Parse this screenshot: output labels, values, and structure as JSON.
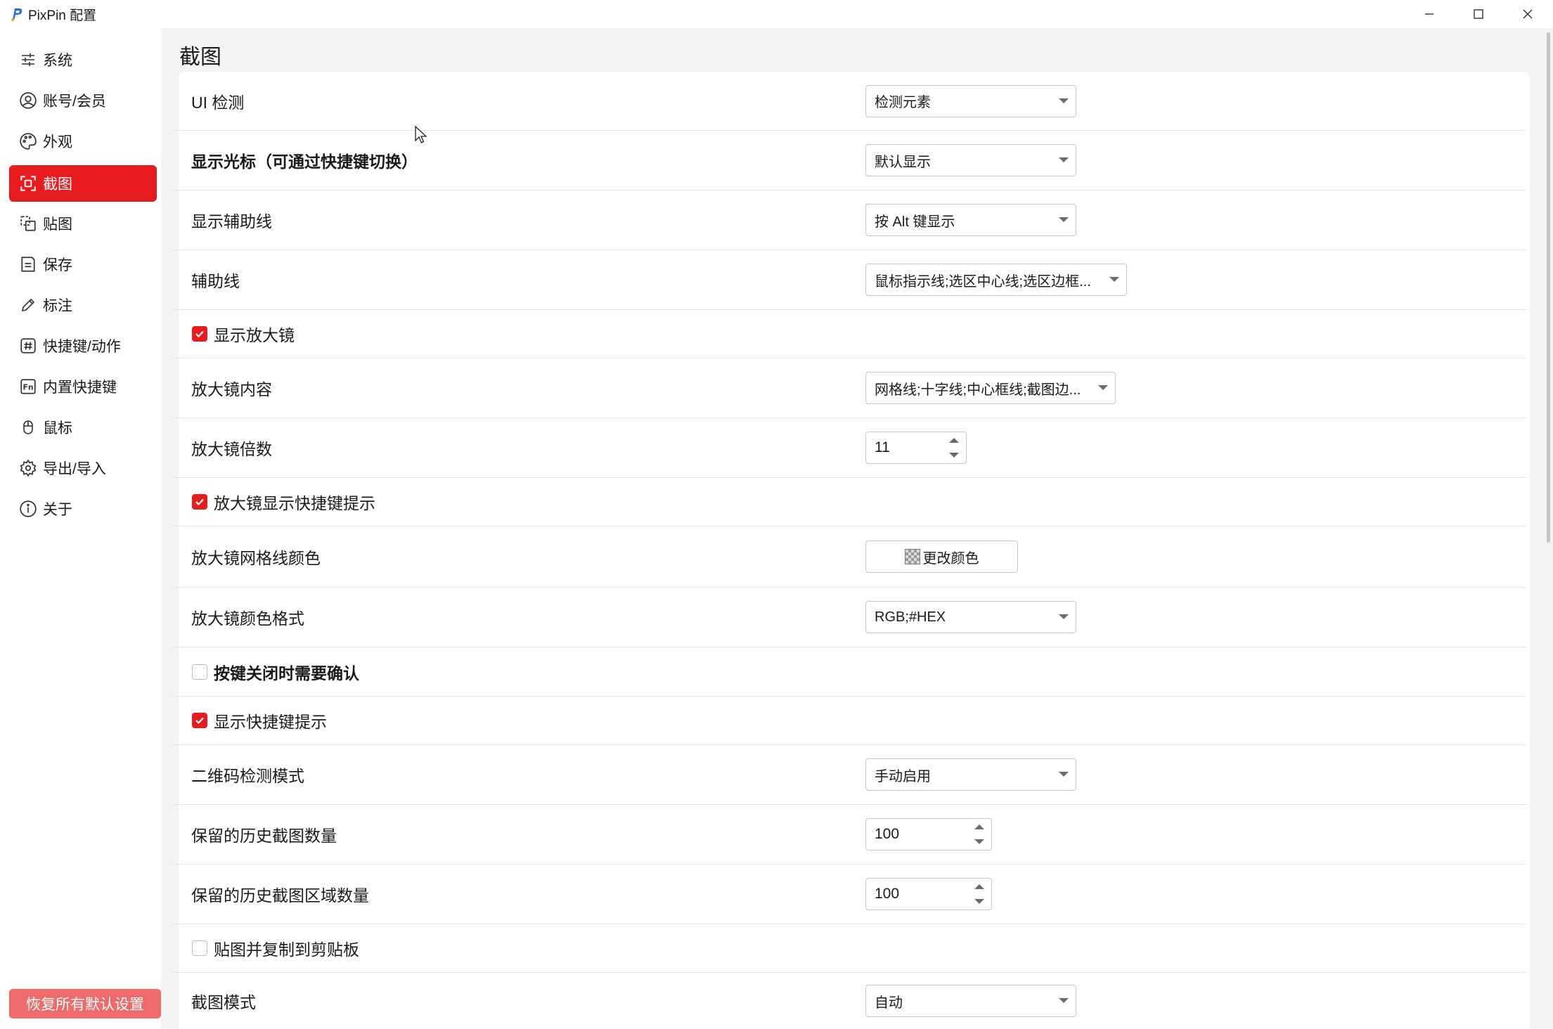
{
  "window": {
    "title": "PixPin 配置"
  },
  "sidebar": {
    "items": [
      {
        "label": "系统",
        "icon": "sliders-icon"
      },
      {
        "label": "账号/会员",
        "icon": "user-circle-icon"
      },
      {
        "label": "外观",
        "icon": "palette-icon"
      },
      {
        "label": "截图",
        "icon": "screenshot-icon",
        "active": true
      },
      {
        "label": "贴图",
        "icon": "pin-icon"
      },
      {
        "label": "保存",
        "icon": "save-icon"
      },
      {
        "label": "标注",
        "icon": "pen-icon"
      },
      {
        "label": "快捷键/动作",
        "icon": "hash-icon"
      },
      {
        "label": "内置快捷键",
        "icon": "fn-key-icon"
      },
      {
        "label": "鼠标",
        "icon": "mouse-icon"
      },
      {
        "label": "导出/导入",
        "icon": "gear-icon"
      },
      {
        "label": "关于",
        "icon": "info-icon"
      }
    ],
    "reset_button": "恢复所有默认设置"
  },
  "page": {
    "title": "截图"
  },
  "settings": {
    "ui_detect": {
      "label": "UI 检测",
      "value": "检测元素"
    },
    "show_cursor": {
      "label": "显示光标（可通过快捷键切换）",
      "value": "默认显示"
    },
    "show_guides": {
      "label": "显示辅助线",
      "value": "按 Alt 键显示"
    },
    "guides": {
      "label": "辅助线",
      "value": "鼠标指示线;选区中心线;选区边框..."
    },
    "show_magnifier": {
      "label": "显示放大镜",
      "checked": true
    },
    "magnifier_content": {
      "label": "放大镜内容",
      "value": "网格线;十字线;中心框线;截图边..."
    },
    "magnifier_zoom": {
      "label": "放大镜倍数",
      "value": "11"
    },
    "magnifier_hotkey_hint": {
      "label": "放大镜显示快捷键提示",
      "checked": true
    },
    "magnifier_grid_color": {
      "label": "放大镜网格线颜色",
      "button": "更改颜色"
    },
    "magnifier_color_format": {
      "label": "放大镜颜色格式",
      "value": "RGB;#HEX"
    },
    "confirm_close_key": {
      "label": "按键关闭时需要确认",
      "checked": false
    },
    "show_hotkey_hint": {
      "label": "显示快捷键提示",
      "checked": true
    },
    "qr_detect_mode": {
      "label": "二维码检测模式",
      "value": "手动启用"
    },
    "history_count": {
      "label": "保留的历史截图数量",
      "value": "100"
    },
    "history_region_count": {
      "label": "保留的历史截图区域数量",
      "value": "100"
    },
    "pin_copy_clipboard": {
      "label": "贴图并复制到剪贴板",
      "checked": false
    },
    "capture_mode": {
      "label": "截图模式",
      "value": "自动"
    }
  },
  "colors": {
    "accent": "#e81b1f",
    "reset_button": "#ef6b6b",
    "main_bg": "#f3f3f3"
  }
}
